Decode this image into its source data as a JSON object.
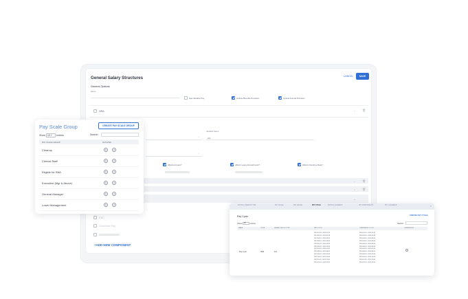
{
  "salary_structures": {
    "title": "General Salary Structures",
    "cancel_label": "CANCEL",
    "save_label": "SAVE",
    "general_options_label": "General Options",
    "name_label": "Name",
    "checkboxes": [
      {
        "label": "Has Variable Pay",
        "checked": false
      },
      {
        "label": "Include Benefits Provision",
        "checked": true
      },
      {
        "label": "Include Annual Provision",
        "checked": true
      }
    ],
    "component_name": "HRA",
    "variable_name_label": "Variable Name",
    "variable_name_value": "hra",
    "affects": [
      {
        "label": "Affects Arrears?",
        "checked": true
      },
      {
        "label": "Affects Leave Encashment?",
        "checked": true
      },
      {
        "label": "Affects Overtime Rate?",
        "checked": true
      }
    ],
    "row_labels": [
      "EBC",
      "Overtime Pay"
    ],
    "add_component_label": "+ADD NEW COMPONENT",
    "accent": "#2f6fd6"
  },
  "pay_scale_group": {
    "title": "Pay Scale Group",
    "create_label": "CREATE PAY SCALE GROUP",
    "show_label": "Show",
    "entries_value": "10",
    "entries_label": "entries",
    "search_label": "Search:",
    "columns": [
      "PAY SCALE GROUP",
      "ACTIONS"
    ],
    "rows": [
      "Cleanup",
      "Clerical Staff",
      "Eligible for SBA",
      "Executive (Mgr & Above)",
      "General Manager",
      "Lower Management"
    ],
    "action_icons": [
      "edit-icon",
      "delete-icon"
    ]
  },
  "pay_cycle": {
    "tabs": [
      "PAYROLL PERIOD TYPE",
      "PAY SCALE",
      "PAY GRADE",
      "PAY CYCLE",
      "PAYROLL ELEMENT",
      "PAY COMPONENTS",
      "PAY CALENDAR"
    ],
    "active_tab": "PAY CYCLE",
    "title": "Pay Cycle",
    "create_label": "CREATE PAY CYCLE",
    "show_label": "Show",
    "entries_value": "10",
    "entries_label": "entries",
    "search_label": "Search:",
    "columns": [
      "NAME",
      "CODE",
      "SALARY SETUP TYPE",
      "PAY CYCLE",
      "STATEMENT CYCLE",
      "OPERATIONS"
    ],
    "row": {
      "name": "Pay Cycle",
      "code": "ZMD",
      "salary_setup_type": "Full"
    },
    "pay_cycle_dates": [
      "2021-01-01 - 2021-01-31",
      "2021-02-01 - 2021-02-28",
      "2021-03-01 - 2021-03-31",
      "2021-04-01 - 2021-04-30",
      "2021-05-01 - 2021-05-31",
      "2021-06-01 - 2021-06-30",
      "2021-07-01 - 2021-07-31",
      "2021-08-01 - 2021-08-31",
      "2021-09-01 - 2021-09-30",
      "2021-10-01 - 2021-10-31",
      "2021-11-01 - 2021-11-30",
      "2021-12-01 - 2021-12-31"
    ],
    "statement_cycle_dates": [
      "2021-01-01 - 2021-01-31",
      "2021-02-01 - 2021-02-28",
      "2021-03-01 - 2021-03-31",
      "2021-04-01 - 2021-04-30",
      "2021-05-01 - 2021-05-31",
      "2021-06-01 - 2021-06-30",
      "2021-07-01 - 2021-07-31",
      "2021-08-01 - 2021-08-31",
      "2021-09-01 - 2021-09-30",
      "2021-10-01 - 2021-10-31",
      "2021-11-01 - 2021-11-30",
      "2021-12-01 - 2021-12-31"
    ]
  }
}
